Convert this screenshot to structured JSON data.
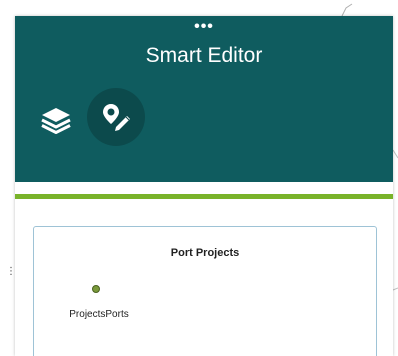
{
  "panel": {
    "title": "Smart Editor",
    "drag_handle": "•••"
  },
  "toolbar": {
    "layers_icon": "layers-icon",
    "edit_icon": "edit-feature-icon"
  },
  "template": {
    "layer_title": "Port Projects",
    "items": [
      {
        "label": "ProjectsPorts",
        "symbol_color": "#7a9a3a"
      }
    ]
  },
  "map": {
    "handle_dots": "⋮"
  },
  "colors": {
    "header": "#0f5c5f",
    "tool_active_bg": "#0c4a4c",
    "accent": "#79b32a",
    "card_border": "#9ec3d6"
  }
}
